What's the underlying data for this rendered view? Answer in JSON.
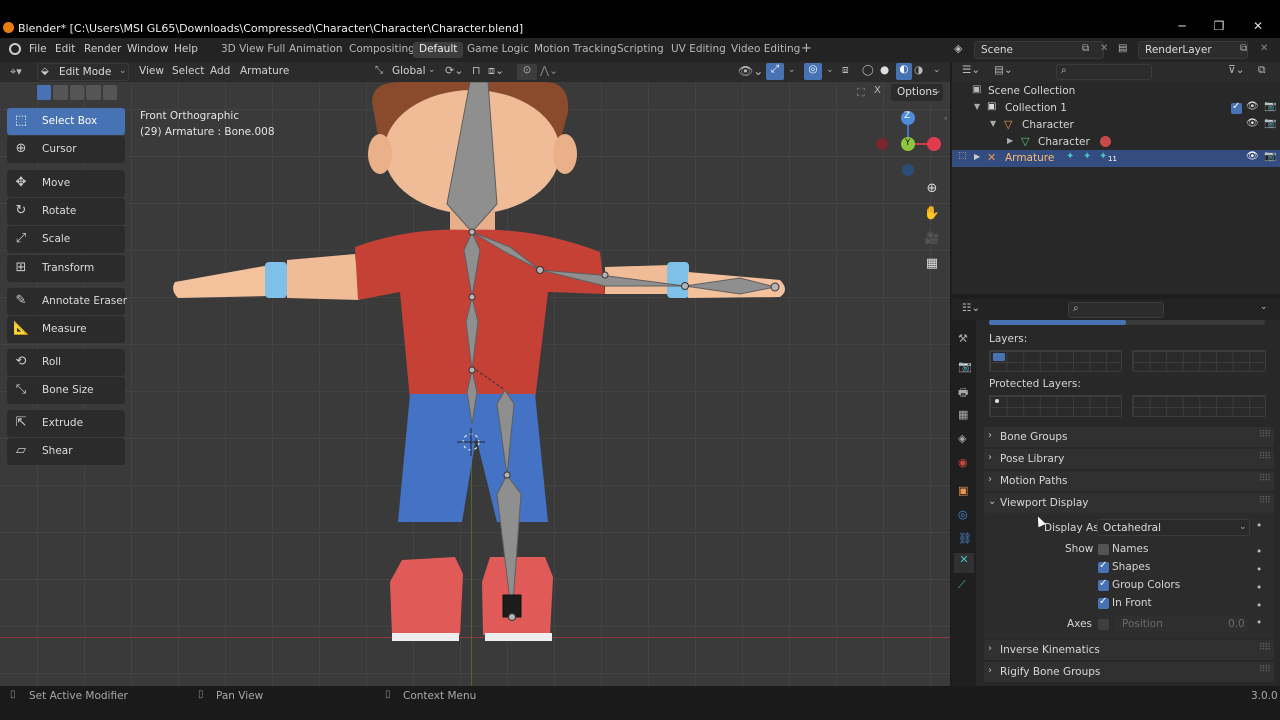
{
  "window": {
    "title": "Blender* [C:\\Users\\MSI GL65\\Downloads\\Compressed\\Character\\Character\\Character.blend]",
    "minimize": "─",
    "maximize": "❐",
    "close": "✕"
  },
  "menu": [
    "File",
    "Edit",
    "Render",
    "Window",
    "Help"
  ],
  "workspaces": [
    "3D View Full",
    "Animation",
    "Compositing",
    "Default",
    "Game Logic",
    "Motion Tracking",
    "Scripting",
    "UV Editing",
    "Video Editing"
  ],
  "active_workspace": "Default",
  "add_workspace": "+",
  "scene": "Scene",
  "view_layer": "RenderLayer",
  "viewport_header": {
    "mode": "Edit Mode",
    "menus": [
      "View",
      "Select",
      "Add",
      "Armature"
    ],
    "orientation": "Global",
    "options": "Options"
  },
  "viewport": {
    "view_name": "Front Orthographic",
    "object_info": "(29) Armature : Bone.008",
    "gizmo_z": "Z",
    "gizmo_y": "Y"
  },
  "toolbar": [
    {
      "label": "Select Box",
      "icon": "select-box-icon",
      "glyph": "⬚",
      "active": true
    },
    {
      "label": "Cursor",
      "icon": "cursor-icon",
      "glyph": "⊕",
      "active": false
    },
    {
      "label": "Move",
      "icon": "move-icon",
      "glyph": "✥",
      "active": false
    },
    {
      "label": "Rotate",
      "icon": "rotate-icon",
      "glyph": "↻",
      "active": false
    },
    {
      "label": "Scale",
      "icon": "scale-icon",
      "glyph": "⤢",
      "active": false
    },
    {
      "label": "Transform",
      "icon": "transform-icon",
      "glyph": "⊞",
      "active": false
    },
    {
      "label": "Annotate Eraser",
      "icon": "annotate-eraser-icon",
      "glyph": "✎",
      "active": false
    },
    {
      "label": "Measure",
      "icon": "measure-icon",
      "glyph": "📐",
      "active": false
    },
    {
      "label": "Roll",
      "icon": "roll-icon",
      "glyph": "⟲",
      "active": false
    },
    {
      "label": "Bone Size",
      "icon": "bone-size-icon",
      "glyph": "⤡",
      "active": false
    },
    {
      "label": "Extrude",
      "icon": "extrude-icon",
      "glyph": "⇱",
      "active": false
    },
    {
      "label": "Shear",
      "icon": "shear-icon",
      "glyph": "▱",
      "active": false
    }
  ],
  "outliner": {
    "rows": [
      {
        "label": "Scene Collection",
        "icon": "scene-collection-icon"
      },
      {
        "label": "Collection 1",
        "icon": "collection-icon"
      },
      {
        "label": "Character",
        "icon": "mesh-object-icon"
      },
      {
        "label": "Character",
        "icon": "mesh-data-icon"
      },
      {
        "label": "Armature",
        "icon": "armature-icon",
        "selected": true
      }
    ],
    "armature_badge": "11"
  },
  "properties": {
    "layers_label": "Layers:",
    "protected_layers_label": "Protected Layers:",
    "panels_collapsed": [
      "Bone Groups",
      "Pose Library",
      "Motion Paths"
    ],
    "viewport_display": {
      "title": "Viewport Display",
      "display_as_label": "Display As",
      "display_as_value": "Octahedral",
      "show_label": "Show",
      "checkboxes": [
        {
          "label": "Names",
          "checked": false
        },
        {
          "label": "Shapes",
          "checked": true
        },
        {
          "label": "Group Colors",
          "checked": true
        },
        {
          "label": "In Front",
          "checked": true
        }
      ],
      "axes_label": "Axes",
      "axes_position_label": "Position",
      "axes_position_value": "0.0"
    },
    "panels_after": [
      "Inverse Kinematics",
      "Rigify Bone Groups"
    ]
  },
  "statusbar": {
    "left": "Set Active Modifier",
    "middle": "Pan View",
    "right": "Context Menu",
    "version": "3.0.0"
  },
  "colors": {
    "accent": "#4772b3",
    "shirt": "#c54136",
    "pants": "#4472c4",
    "shoes": "#e05a58",
    "skin": "#f3c19c",
    "hair": "#8a4a2c",
    "bone": "#8f8f8f"
  }
}
